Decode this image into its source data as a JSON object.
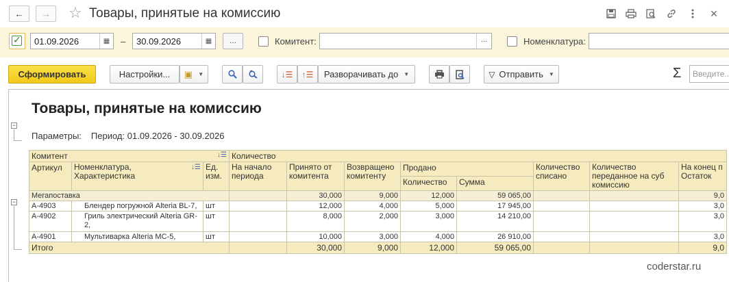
{
  "window": {
    "title": "Товары, принятые на комиссию",
    "back_icon": "←",
    "forward_icon": "→"
  },
  "filters": {
    "date_from": "01.09.2026",
    "date_dash": "–",
    "date_to": "30.09.2026",
    "more_label": "...",
    "commitent_label": "Комитент:",
    "commitent_value": "",
    "nomenclature_label": "Номенклатура:",
    "nomenclature_value": ""
  },
  "toolbar": {
    "generate_label": "Сформировать",
    "settings_label": "Настройки...",
    "expand_label": "Разворачивать до",
    "send_label": "Отправить",
    "sigma_label": "Σ",
    "search_placeholder": "Введите..."
  },
  "report": {
    "title": "Товары, принятые на комиссию",
    "params_label": "Параметры:",
    "params_value": "Период: 01.09.2026 - 30.09.2026",
    "headers": {
      "commitent": "Комитент",
      "article": "Артикул",
      "nomenclature": "Номенклатура, Характеристика",
      "unit": "Ед. изм.",
      "quantity": "Количество",
      "start": "На начало периода",
      "received": "Принято от комитента",
      "returned": "Возвращено комитенту",
      "sold": "Продано",
      "sold_qty": "Количество",
      "sold_sum": "Сумма",
      "written_off": "Количество списано",
      "transferred": "Количество переданное на суб комиссию",
      "end_period": "На конец п",
      "remainder": "Остаток"
    },
    "group": {
      "name": "Мегапоставка",
      "received": "30,000",
      "returned": "9,000",
      "sold_qty": "12,000",
      "sold_sum": "59 065,00",
      "remainder": "9,0"
    },
    "rows": [
      {
        "article": "А-4903",
        "name": "Блендер погружной Alteria BL-7,",
        "unit": "шт",
        "received": "12,000",
        "returned": "4,000",
        "sold_qty": "5,000",
        "sold_sum": "17 945,00",
        "remainder": "3,0"
      },
      {
        "article": "А-4902",
        "name": "Гриль электрический Alteria GR-2,",
        "unit": "шт",
        "received": "8,000",
        "returned": "2,000",
        "sold_qty": "3,000",
        "sold_sum": "14 210,00",
        "remainder": "3,0"
      },
      {
        "article": "А-4901",
        "name": "Мультиварка Alteria MC-5,",
        "unit": "шт",
        "received": "10,000",
        "returned": "3,000",
        "sold_qty": "4,000",
        "sold_sum": "26 910,00",
        "remainder": "3,0"
      }
    ],
    "total": {
      "label": "Итого",
      "received": "30,000",
      "returned": "9,000",
      "sold_qty": "12,000",
      "sold_sum": "59 065,00",
      "remainder": "9,0"
    }
  },
  "watermark": "coderstar.ru"
}
